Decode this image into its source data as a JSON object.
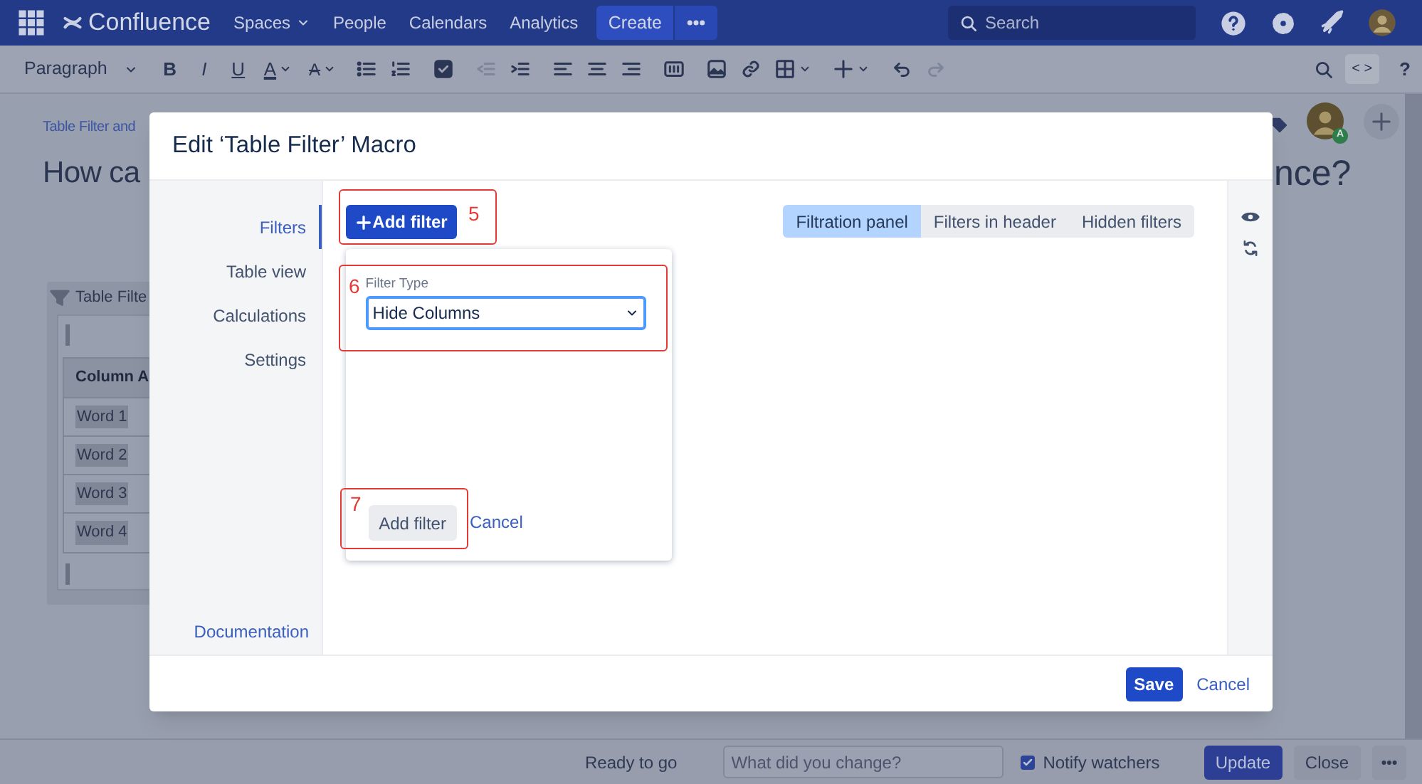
{
  "nav": {
    "logo": "Confluence",
    "items": [
      {
        "label": "Spaces",
        "dropdown": true
      },
      {
        "label": "People",
        "dropdown": false
      },
      {
        "label": "Calendars",
        "dropdown": false
      },
      {
        "label": "Analytics",
        "dropdown": false
      }
    ],
    "create": "Create",
    "search": {
      "placeholder": "Search"
    }
  },
  "toolbar": {
    "paragraph": "Paragraph",
    "format_buttons": [
      "B",
      "I",
      "U"
    ],
    "text_color": "A",
    "clear_format": "A",
    "tools": [
      {
        "kind": "bullet_list",
        "disabled": false
      },
      {
        "kind": "numbered_list",
        "disabled": false
      },
      {
        "kind": "task",
        "disabled": false
      },
      {
        "kind": "outdent",
        "disabled": true
      },
      {
        "kind": "indent",
        "disabled": false
      },
      {
        "kind": "align_left",
        "disabled": false
      },
      {
        "kind": "align_center",
        "disabled": false
      },
      {
        "kind": "align_right",
        "disabled": false
      },
      {
        "kind": "layout",
        "disabled": false
      },
      {
        "kind": "image",
        "disabled": false
      },
      {
        "kind": "link",
        "disabled": false
      },
      {
        "kind": "table",
        "disabled": false
      },
      {
        "kind": "insert",
        "disabled": false
      },
      {
        "kind": "undo",
        "disabled": false
      },
      {
        "kind": "redo",
        "disabled": true
      }
    ],
    "source_toggle": "< >",
    "help": "?"
  },
  "page": {
    "breadcrumb": "Table Filter and",
    "title_start": "How ca",
    "title_end": "nce?",
    "avatar_badge": "A",
    "macro": {
      "title": "Table Filte",
      "header": "Column A",
      "rows": [
        "Word 1",
        "Word 2",
        "Word 3",
        "Word 4"
      ]
    }
  },
  "dialog": {
    "title": "Edit ‘Table Filter’ Macro",
    "nav": [
      {
        "label": "Filters",
        "selected": true
      },
      {
        "label": "Table view",
        "selected": false
      },
      {
        "label": "Calculations",
        "selected": false
      },
      {
        "label": "Settings",
        "selected": false
      }
    ],
    "documentation": "Documentation",
    "add_filter": {
      "label": "Add filter",
      "annotation": "5"
    },
    "modes": [
      {
        "label": "Filtration panel",
        "selected": true
      },
      {
        "label": "Filters in header",
        "selected": false
      },
      {
        "label": "Hidden filters",
        "selected": false
      }
    ],
    "filter_form": {
      "field_label": "Filter Type",
      "value": "Hide Columns",
      "annotation": "6",
      "submit": "Add filter",
      "submit_annotation": "7",
      "cancel": "Cancel"
    },
    "save": "Save",
    "cancel": "Cancel"
  },
  "bottom_bar": {
    "status": "Ready to go",
    "comment": {
      "placeholder": "What did you change?"
    },
    "notify": {
      "label": "Notify watchers",
      "checked": true
    },
    "update": "Update",
    "close": "Close"
  }
}
